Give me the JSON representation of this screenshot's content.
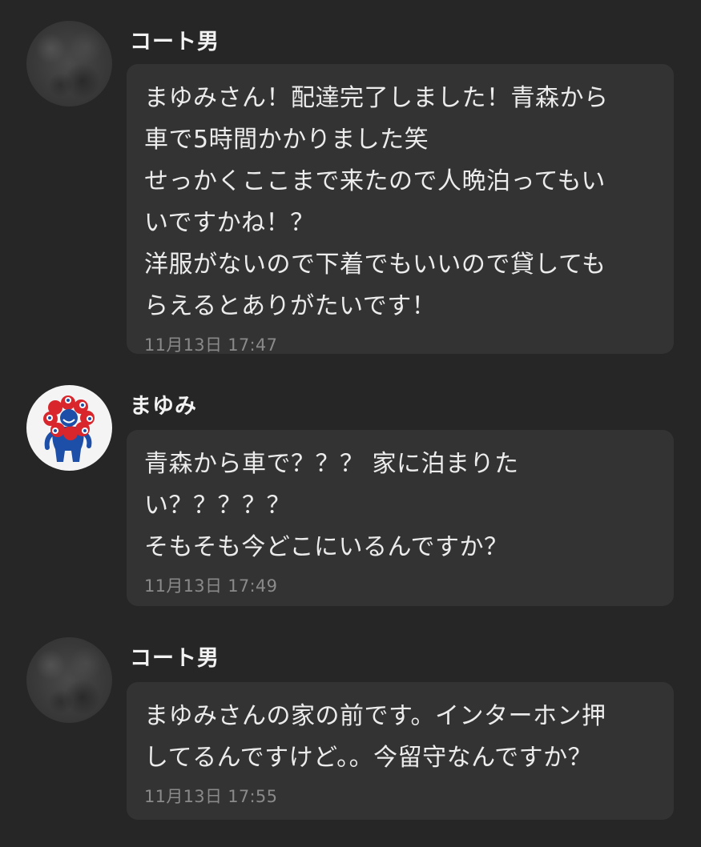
{
  "messages": [
    {
      "sender": "コート男",
      "avatar": "moon-avatar",
      "lines": [
        "まゆみさん！配達完了しました！青森から",
        "車で5時間かかりました笑",
        "せっかくここまで来たので人晩泊ってもい",
        "いですかね！？",
        "洋服がないので下着でもいいので貸しても",
        "らえるとありがたいです！"
      ],
      "time": "11月13日 17:47"
    },
    {
      "sender": "まゆみ",
      "avatar": "mascot-avatar",
      "lines": [
        "青森から車で？？？ 家に泊まりた",
        "い？？？？？",
        "そもそも今どこにいるんですか？"
      ],
      "time": "11月13日 17:49"
    },
    {
      "sender": "コート男",
      "avatar": "moon-avatar",
      "lines": [
        "まゆみさんの家の前です。インターホン押",
        "してるんですけど。。今留守なんですか？"
      ],
      "time": "11月13日 17:55"
    }
  ],
  "colors": {
    "background": "#262626",
    "bubble": "#333333",
    "text": "#ececec",
    "timestamp": "#8a8a8a",
    "mascot_red": "#d8262c",
    "mascot_blue": "#1d4fa8"
  }
}
